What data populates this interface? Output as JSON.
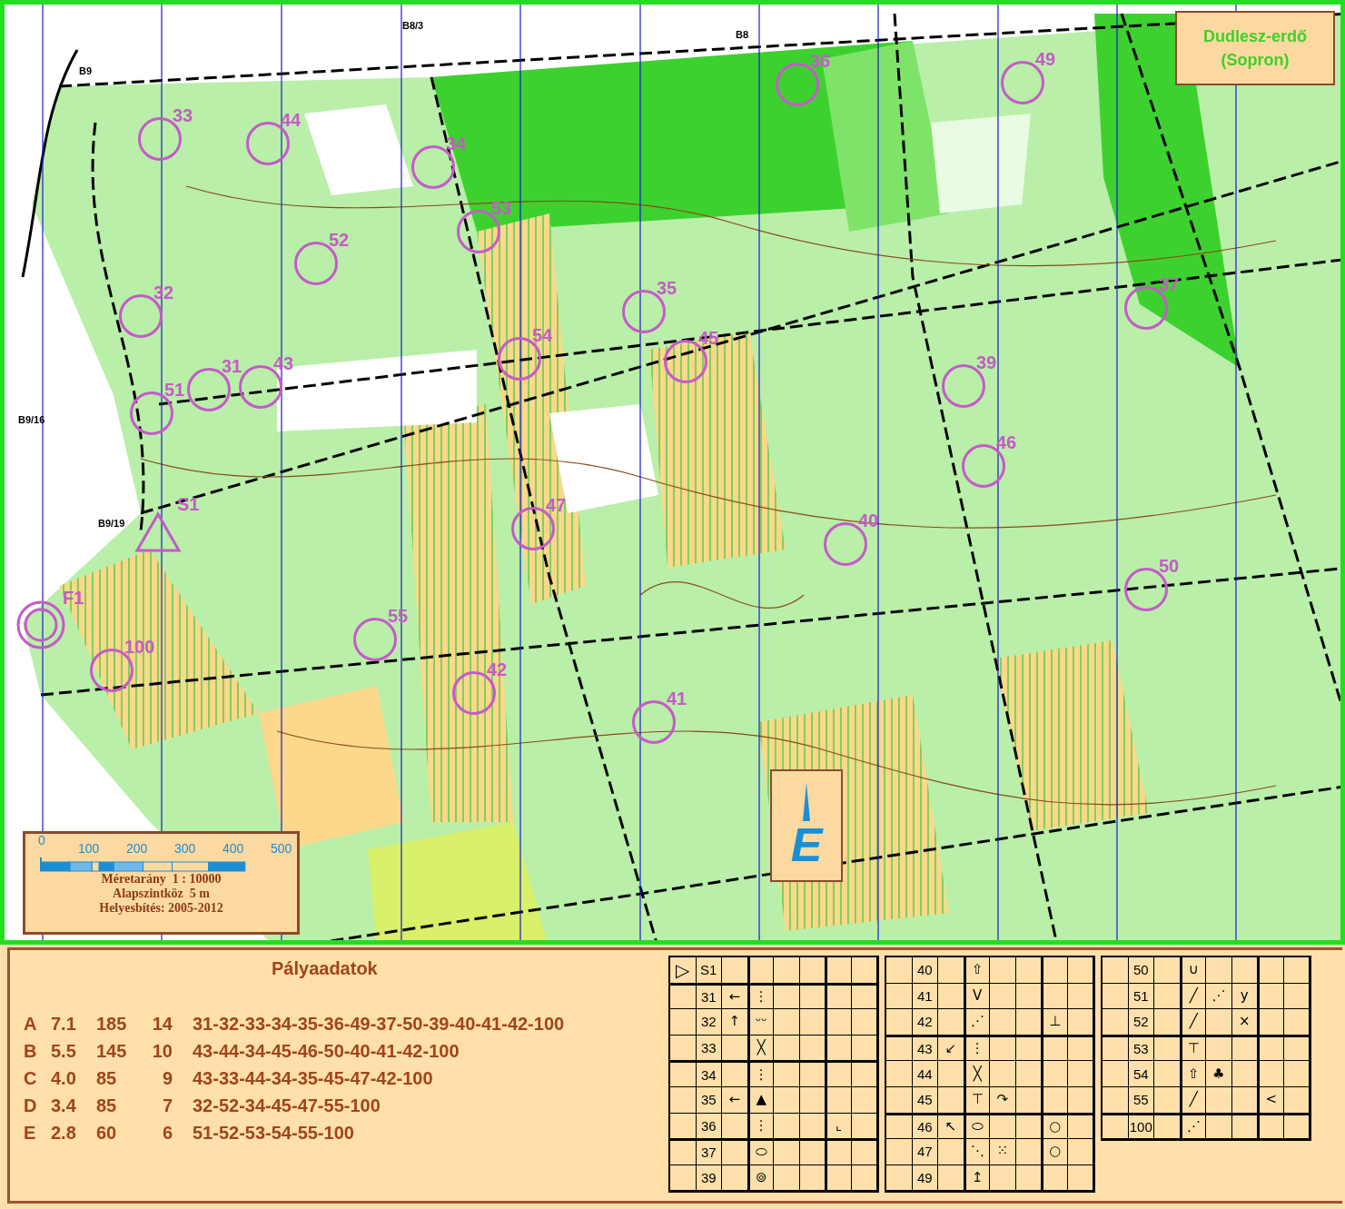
{
  "map": {
    "title": [
      "Dudlesz-erdő",
      "(Sopron)"
    ],
    "place_labels": [
      "B8/3",
      "B8",
      "B9",
      "B9/16",
      "B9/19"
    ],
    "start": {
      "label": "S1"
    },
    "finish": {
      "label": "F1"
    },
    "controls": [
      {
        "number": "33"
      },
      {
        "number": "44"
      },
      {
        "number": "34"
      },
      {
        "number": "53"
      },
      {
        "number": "52"
      },
      {
        "number": "32"
      },
      {
        "number": "54"
      },
      {
        "number": "35"
      },
      {
        "number": "45"
      },
      {
        "number": "31"
      },
      {
        "number": "43"
      },
      {
        "number": "51"
      },
      {
        "number": "47"
      },
      {
        "number": "36"
      },
      {
        "number": "49"
      },
      {
        "number": "37"
      },
      {
        "number": "39"
      },
      {
        "number": "46"
      },
      {
        "number": "40"
      },
      {
        "number": "50"
      },
      {
        "number": "55"
      },
      {
        "number": "100"
      },
      {
        "number": "42"
      },
      {
        "number": "41"
      }
    ],
    "scale": {
      "ticks": [
        "0",
        "100",
        "200",
        "300",
        "400",
        "500"
      ],
      "lines": [
        "Méretarány  1 : 10000",
        "Alapszintköz  5 m",
        "Helyesbítés: 2005-2012"
      ]
    },
    "north": {
      "label": "E"
    }
  },
  "course_panel": {
    "title": "Pályaadatok",
    "courses": [
      {
        "name": "A",
        "length": "7.1",
        "climb": "185",
        "controls": "14",
        "sequence": "31-32-33-34-35-36-49-37-50-39-40-41-42-100"
      },
      {
        "name": "B",
        "length": "5.5",
        "climb": "145",
        "controls": "10",
        "sequence": "43-44-34-45-46-50-40-41-42-100"
      },
      {
        "name": "C",
        "length": "4.0",
        "climb": "85",
        "controls": "9",
        "sequence": "43-33-44-34-35-45-47-42-100"
      },
      {
        "name": "D",
        "length": "3.4",
        "climb": "85",
        "controls": "7",
        "sequence": "32-52-34-45-47-55-100"
      },
      {
        "name": "E",
        "length": "2.8",
        "climb": "60",
        "controls": "6",
        "sequence": "51-52-53-54-55-100"
      }
    ]
  },
  "descriptions": [
    {
      "rows": [
        {
          "mark": "▷",
          "code": "S1"
        },
        {
          "code": "31",
          "which": "←",
          "feature": "⋮"
        },
        {
          "code": "32",
          "which": "↑",
          "feature": "ᵕᵕ"
        },
        {
          "code": "33",
          "feature": "╳"
        },
        {
          "code": "34",
          "feature": "⋮"
        },
        {
          "code": "35",
          "which": "←",
          "feature": "▲"
        },
        {
          "code": "36",
          "feature": "⋮",
          "location": "⌞"
        },
        {
          "code": "37",
          "feature": "⬭"
        },
        {
          "code": "39",
          "feature": "⊚"
        }
      ]
    },
    {
      "rows": [
        {
          "code": "40",
          "feature": "⇧"
        },
        {
          "code": "41",
          "feature": "V"
        },
        {
          "code": "42",
          "feature": "⋰",
          "location": "⊥"
        },
        {
          "code": "43",
          "which": "↙",
          "feature": "⋮"
        },
        {
          "code": "44",
          "feature": "╳"
        },
        {
          "code": "45",
          "feature": "⊤",
          "appearance": "↷"
        },
        {
          "code": "46",
          "which": "↖",
          "feature": "⬭",
          "location": "○"
        },
        {
          "code": "47",
          "feature": "⋱",
          "appearance": "⁙",
          "location": "○"
        },
        {
          "code": "49",
          "feature": "↥"
        }
      ]
    },
    {
      "rows": [
        {
          "code": "50",
          "feature": "∪"
        },
        {
          "code": "51",
          "feature": "╱",
          "appearance": "⋰",
          "dimension": "y"
        },
        {
          "code": "52",
          "feature": "╱",
          "dimension": "×"
        },
        {
          "code": "53",
          "feature": "⊤"
        },
        {
          "code": "54",
          "feature": "⇧",
          "appearance": "♣"
        },
        {
          "code": "55",
          "feature": "╱",
          "location": "<"
        },
        {
          "code": "100",
          "feature": "⋰"
        }
      ]
    }
  ]
}
